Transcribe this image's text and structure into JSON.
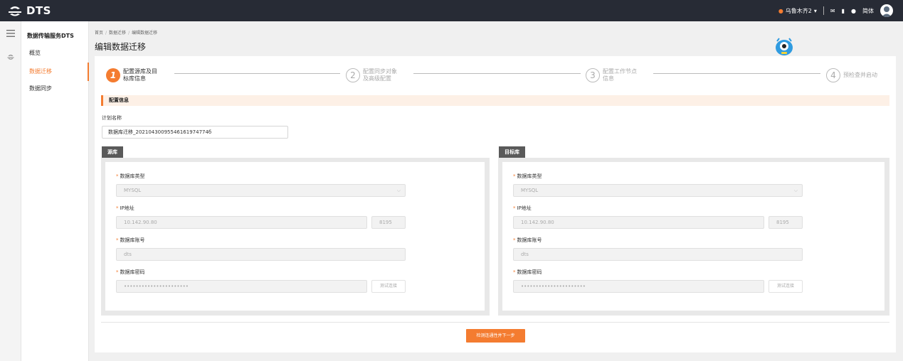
{
  "app": {
    "name": "DTS"
  },
  "topbar": {
    "region": "乌鲁木齐2",
    "language": "简体"
  },
  "sidebar": {
    "title": "数据传输服务DTS",
    "items": [
      {
        "label": "概览"
      },
      {
        "label": "数据迁移"
      },
      {
        "label": "数据同步"
      }
    ],
    "active_index": 1
  },
  "breadcrumb": [
    {
      "label": "首页"
    },
    {
      "label": "数据迁移"
    },
    {
      "label": "编辑数据迁移"
    }
  ],
  "page_title": "编辑数据迁移",
  "steps": [
    {
      "num": "1",
      "line1": "配置源库及目",
      "line2": "标库信息"
    },
    {
      "num": "2",
      "line1": "配置同步对象",
      "line2": "及高级配置"
    },
    {
      "num": "3",
      "line1": "配置工作节点",
      "line2": "信息"
    },
    {
      "num": "4",
      "line1": "预检查并启动",
      "line2": ""
    }
  ],
  "section_title": "配置信息",
  "plan": {
    "label": "计划名称",
    "value": "数据库迁移_20210430095546161974774б"
  },
  "source": {
    "tab": "源库",
    "db_type_label": "数据库类型",
    "db_type_value": "MYSQL",
    "ip_label": "IP地址",
    "ip_value": "10.142.90.80",
    "port_value": "8195",
    "account_label": "数据库账号",
    "account_value": "dts",
    "password_label": "数据库密码",
    "password_value": "••••••••••••••••••••••",
    "test_button": "测试连接"
  },
  "target": {
    "tab": "目标库",
    "db_type_label": "数据库类型",
    "db_type_value": "MYSQL",
    "ip_label": "IP地址",
    "ip_value": "10.142.90.80",
    "port_value": "8195",
    "account_label": "数据库账号",
    "account_value": "dts",
    "password_label": "数据库密码",
    "password_value": "••••••••••••••••••••••",
    "test_button": "测试连接"
  },
  "next_button": "检测连通性并下一步",
  "colors": {
    "accent": "#f47c30",
    "topbar": "#272b35"
  }
}
